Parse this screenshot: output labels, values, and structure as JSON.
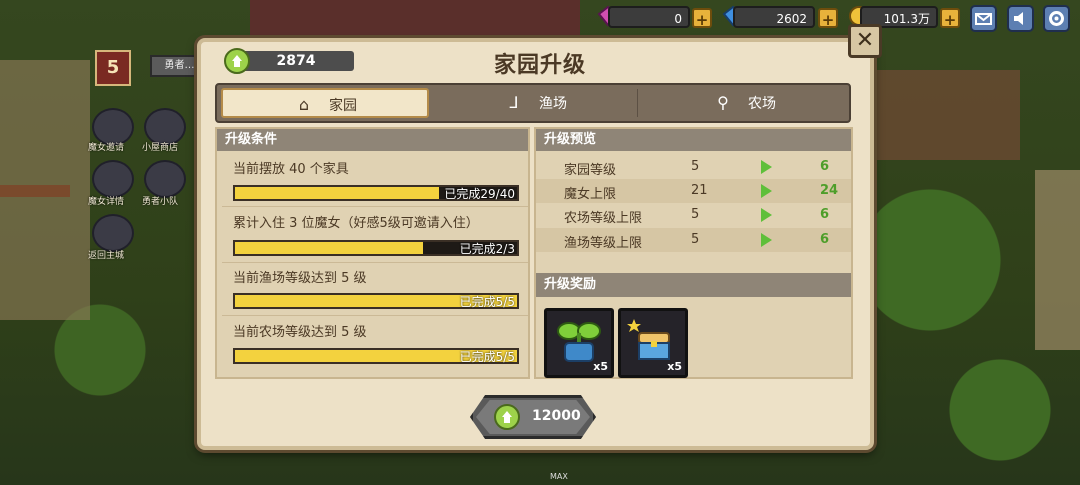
{
  "top_bar": {
    "hearts": "0",
    "gems": "2602",
    "gold": "101.3万"
  },
  "left_menu": [
    {
      "label": "魔女邀请"
    },
    {
      "label": "小屋商店"
    },
    {
      "label": "魔女详情"
    },
    {
      "label": "勇者小队"
    },
    {
      "label": "返回主城"
    }
  ],
  "scene": {
    "level": "5",
    "banner": "勇者…",
    "max_label": "MAX"
  },
  "dialog": {
    "title": "家园升级",
    "home_coins": "2874",
    "close_symbol": "✕",
    "tabs": [
      {
        "label": "家园",
        "icon": "house-icon",
        "active": true
      },
      {
        "label": "渔场",
        "icon": "fishhook-icon",
        "active": false
      },
      {
        "label": "农场",
        "icon": "shovel-icon",
        "active": false
      }
    ],
    "conditions_header": "升级条件",
    "conditions": [
      {
        "text": "当前摆放 40 个家具",
        "progress": "已完成29/40",
        "ratio": 0.725
      },
      {
        "text": "累计入住 3 位魔女（好感5级可邀请入住）",
        "progress": "已完成2/3",
        "ratio": 0.667
      },
      {
        "text": "当前渔场等级达到 5 级",
        "progress": "已完成5/5",
        "ratio": 1.0
      },
      {
        "text": "当前农场等级达到 5 级",
        "progress": "已完成5/5",
        "ratio": 1.0
      }
    ],
    "preview_header": "升级预览",
    "preview": [
      {
        "label": "家园等级",
        "current": "5",
        "next": "6"
      },
      {
        "label": "魔女上限",
        "current": "21",
        "next": "24"
      },
      {
        "label": "农场等级上限",
        "current": "5",
        "next": "6"
      },
      {
        "label": "渔场等级上限",
        "current": "5",
        "next": "6"
      }
    ],
    "rewards_header": "升级奖励",
    "rewards": [
      {
        "icon": "sprout-pot-icon",
        "qty": "x5"
      },
      {
        "icon": "chest-icon",
        "qty": "x5"
      }
    ],
    "upgrade_cost": "12000"
  },
  "colors": {
    "progress_fill": "#f3d23e",
    "next_value": "#4e9e2a",
    "panel_bg": "#ede1c7",
    "header_bg": "#8f8577"
  }
}
